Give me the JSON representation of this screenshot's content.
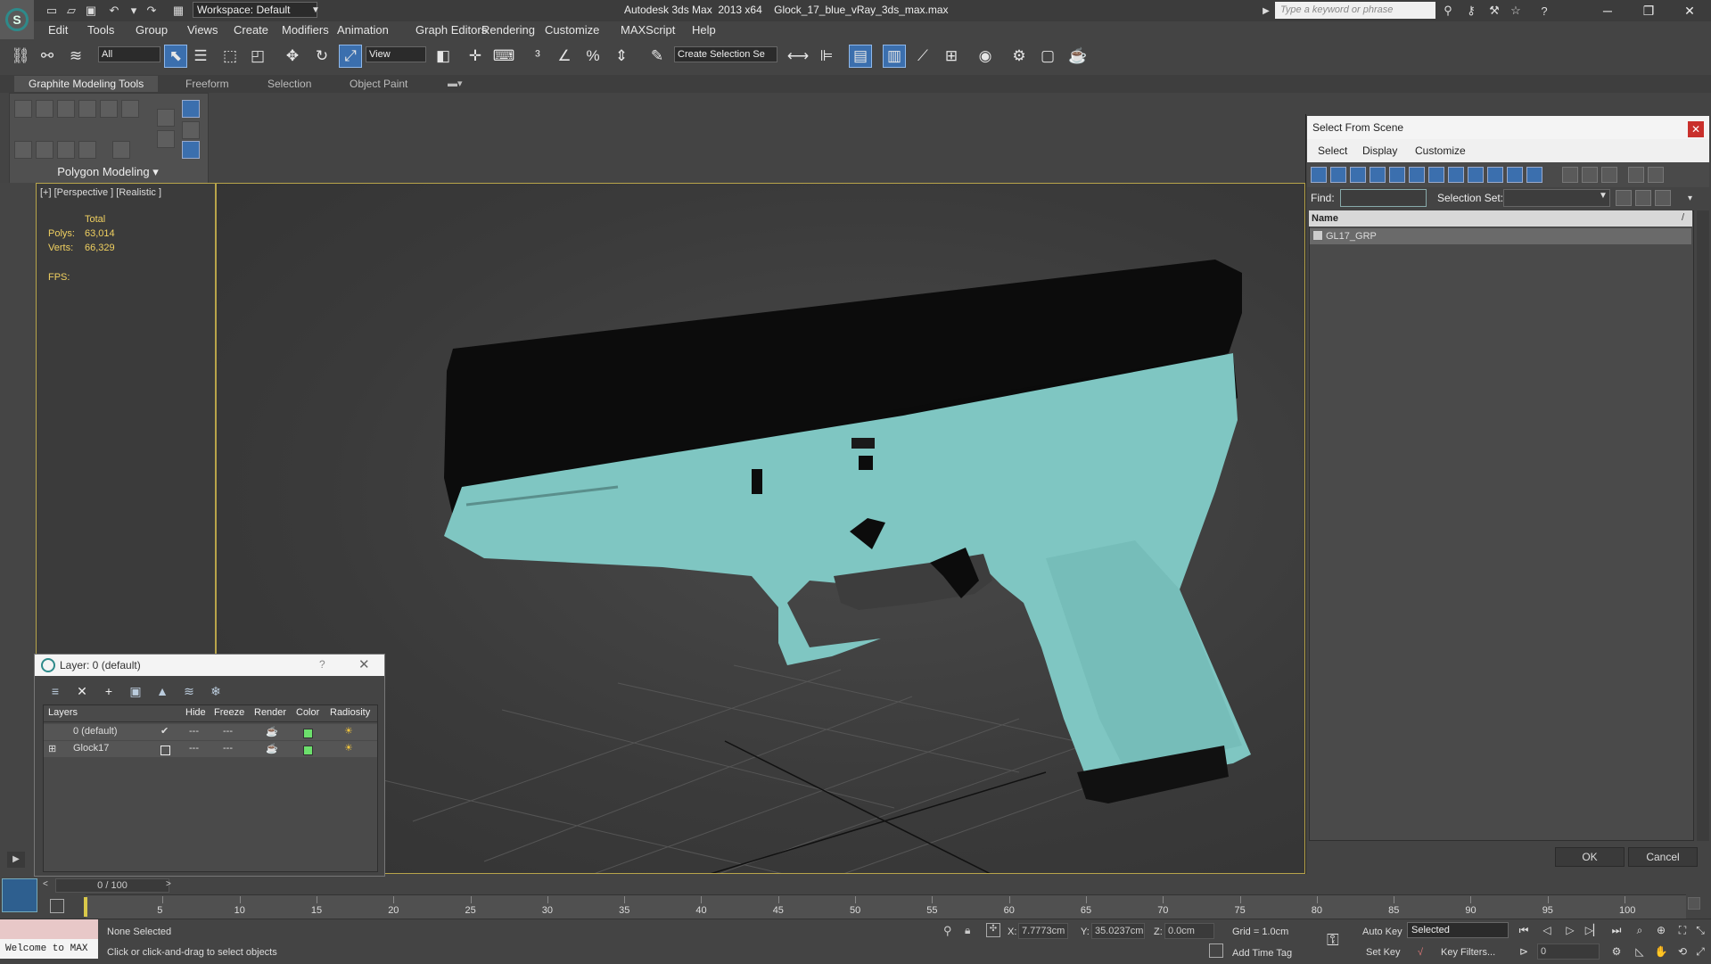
{
  "titlebar": {
    "workspace": "Workspace: Default",
    "app_title": "Autodesk 3ds Max  2013 x64",
    "file_name": "Glock_17_blue_vRay_3ds_max.max",
    "search_placeholder": "Type a keyword or phrase"
  },
  "menu": [
    "Edit",
    "Tools",
    "Group",
    "Views",
    "Create",
    "Modifiers",
    "Animation",
    "Graph Editors",
    "Rendering",
    "Customize",
    "MAXScript",
    "Help"
  ],
  "toolbar": {
    "filter_value": "All",
    "ref_coord_value": "View",
    "selection_set_placeholder": "Create Selection Se"
  },
  "ribbon": {
    "tabs": [
      "Graphite Modeling Tools",
      "Freeform",
      "Selection",
      "Object Paint"
    ],
    "panel_label": "Polygon Modeling"
  },
  "viewport": {
    "label": "[+] [Perspective ] [Realistic ]",
    "stats": {
      "total_label": "Total",
      "polys_label": "Polys:",
      "polys_value": "63,014",
      "verts_label": "Verts:",
      "verts_value": "66,329",
      "fps_label": "FPS:"
    }
  },
  "select_from_scene": {
    "title": "Select From Scene",
    "menus": [
      "Select",
      "Display",
      "Customize"
    ],
    "find_label": "Find:",
    "selection_set_label": "Selection Set:",
    "column_name": "Name",
    "rows": [
      "GL17_GRP"
    ],
    "ok": "OK",
    "cancel": "Cancel"
  },
  "layer_dialog": {
    "title": "Layer: 0 (default)",
    "help": "?",
    "columns": [
      "Layers",
      "Hide",
      "Freeze",
      "Render",
      "Color",
      "Radiosity"
    ],
    "rows": [
      {
        "name": "0 (default)",
        "active": true,
        "color": "#6ce06c"
      },
      {
        "name": "Glock17",
        "active": false,
        "color": "#6ce06c"
      }
    ]
  },
  "timeline": {
    "frame_readout": "0 / 100",
    "ticks": [
      "5",
      "10",
      "15",
      "20",
      "25",
      "30",
      "35",
      "40",
      "45",
      "50",
      "55",
      "60",
      "65",
      "70",
      "75",
      "80",
      "85",
      "90",
      "95",
      "100"
    ]
  },
  "status": {
    "welcome": "Welcome to MAX",
    "selection": "None Selected",
    "prompt": "Click or click-and-drag to select objects",
    "x_label": "X:",
    "x_value": "7.7773cm",
    "y_label": "Y:",
    "y_value": "35.0237cm",
    "z_label": "Z:",
    "z_value": "0.0cm",
    "grid": "Grid = 1.0cm",
    "auto_key": "Auto Key",
    "selected": "Selected",
    "set_key": "Set Key",
    "key_filters": "Key Filters...",
    "add_time_tag": "Add Time Tag",
    "current_frame": "0"
  },
  "colors": {
    "gun_body": "#7fc6c2",
    "slide": "#0c0c0c",
    "viewport_border": "#b8a44a",
    "accent": "#3b6fae"
  }
}
